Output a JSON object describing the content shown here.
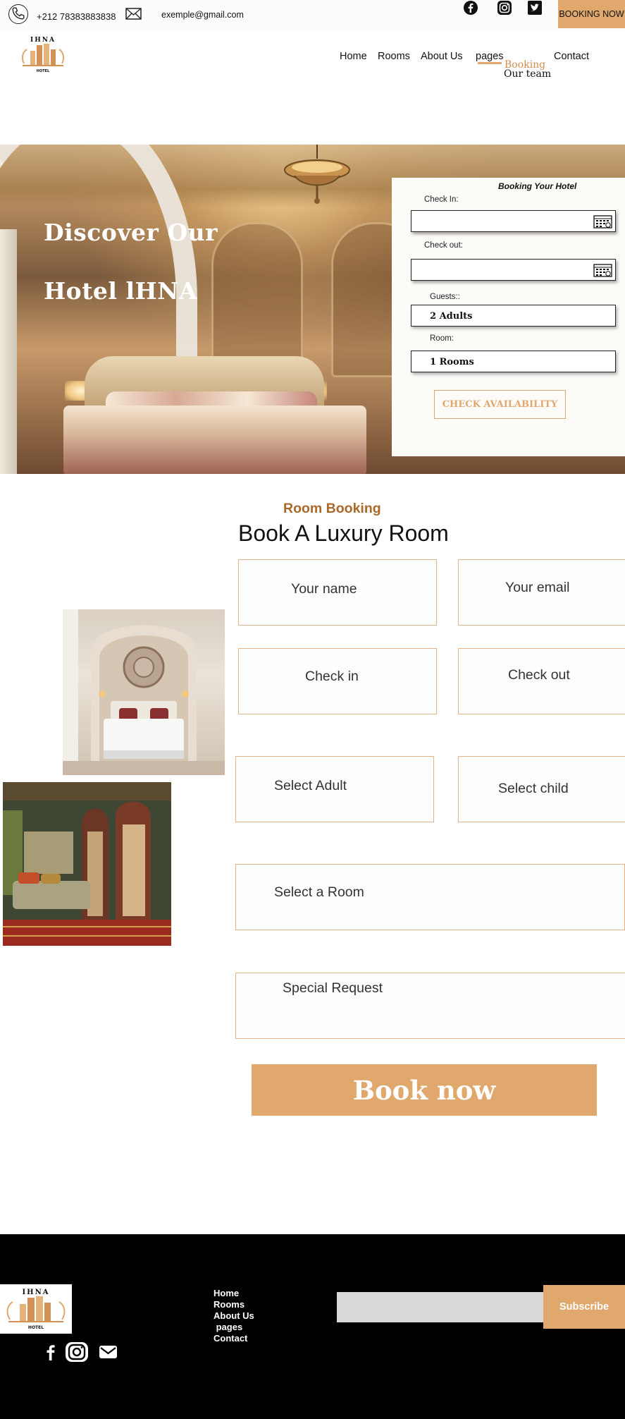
{
  "topbar": {
    "phone": "+212 78383883838",
    "email": "exemple@gmail.com",
    "booking_label": "BOOKING NOW",
    "social_icons": [
      "facebook-icon",
      "instagram-icon",
      "twitter-icon"
    ]
  },
  "nav": {
    "items": [
      "Home",
      "Rooms",
      "About Us",
      "pages",
      "Contact"
    ],
    "pages_dropdown": [
      "Booking",
      "Our team"
    ]
  },
  "logo": {
    "wordmark": "IHNA",
    "sub": "HOTEL"
  },
  "hero": {
    "title_line1": "Discover Our",
    "title_line2": "Hotel lHNA"
  },
  "widget": {
    "title": "Booking Your Hotel",
    "checkin_label": "Check In:",
    "checkout_label": "Check out:",
    "guests_label": "Guests::",
    "guests_value": "2 Adults",
    "room_label": "Room:",
    "room_value": "1 Rooms",
    "button": "CHECK AVAILABILITY"
  },
  "room_booking": {
    "eyebrow": "Room Booking",
    "heading": "Book A Luxury Room",
    "fields": {
      "name": "Your name",
      "email": "Your email",
      "checkin": "Check in",
      "checkout": "Check out",
      "adult": "Select Adult",
      "child": "Select child",
      "room": "Select a Room",
      "request": "Special Request"
    },
    "submit": "Book now"
  },
  "footer": {
    "links": [
      "Home",
      "Rooms",
      "About Us",
      " pages",
      "Contact"
    ],
    "subscribe": "Subscribe",
    "social_icons": [
      "facebook-icon",
      "instagram-icon",
      "mail-icon"
    ]
  },
  "colors": {
    "accent": "#e0a86c",
    "eyebrow": "#a9692b",
    "field_border": "#e4b38a",
    "footer_bg": "#000000"
  }
}
